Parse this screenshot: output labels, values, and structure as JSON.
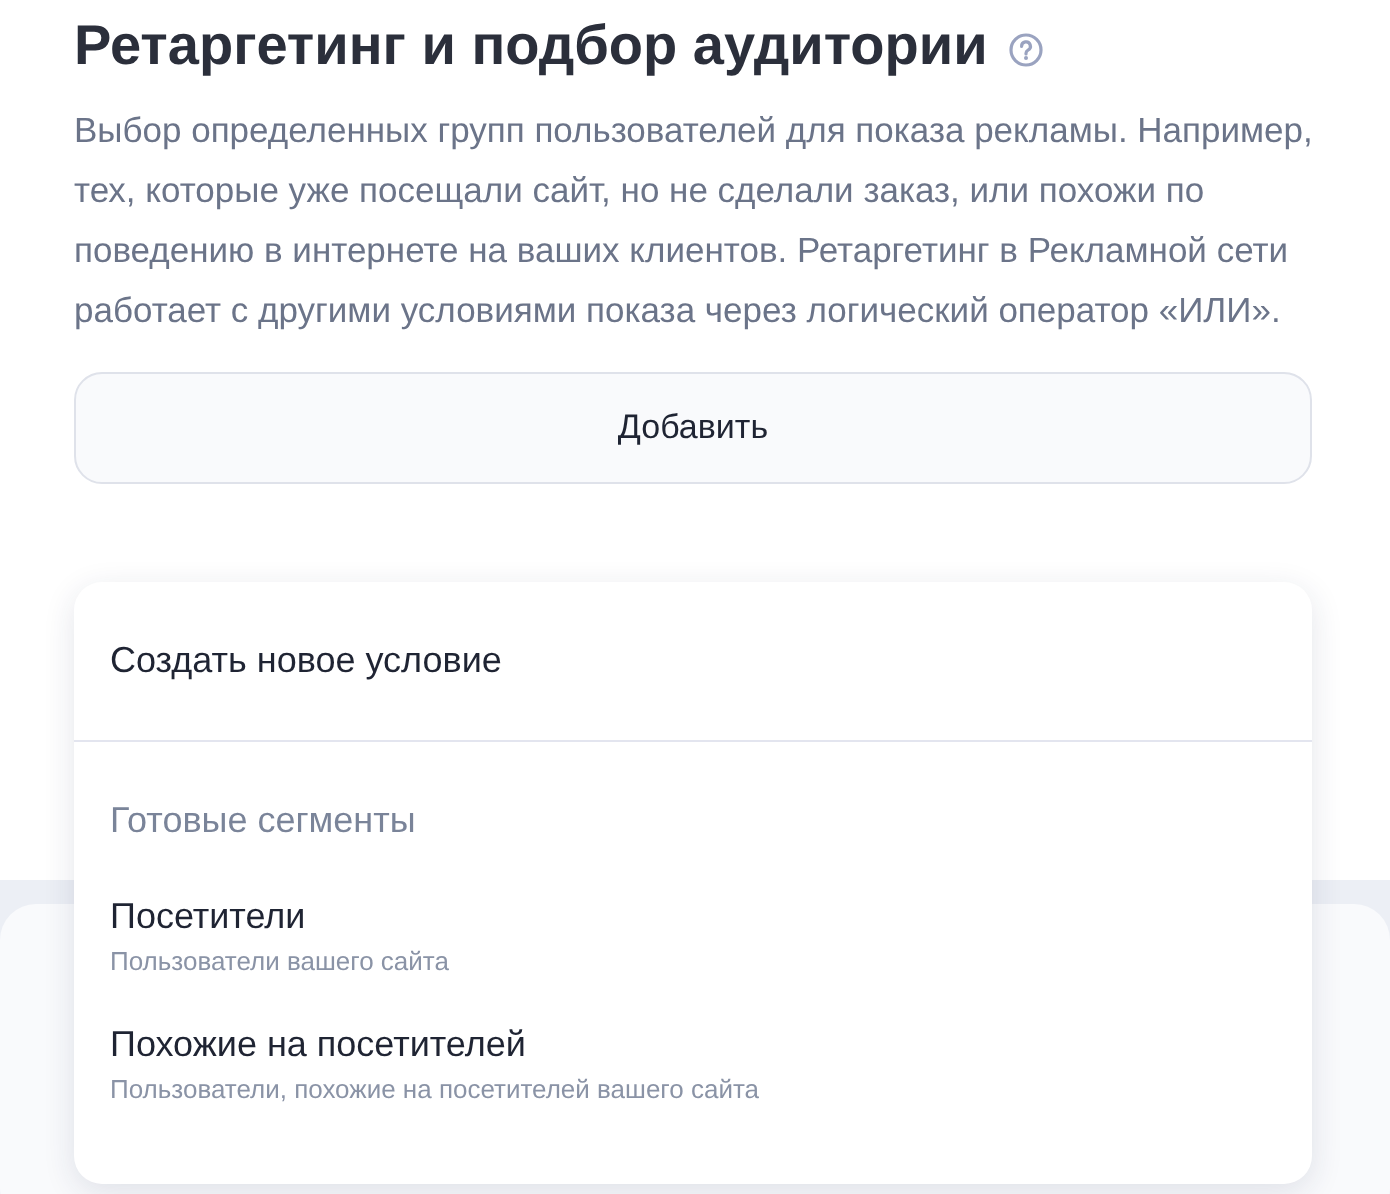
{
  "heading": {
    "title": "Ретаргетинг и подбор аудитории"
  },
  "description": "Выбор определенных групп пользователей для показа рекламы. Например, тех, которые уже посещали сайт, но не сделали заказ, или похожи по поведению в интернете на ваших клиентов. Ретаргетинг в Рекламной сети работает с другими условиями показа через логический оператор «ИЛИ».",
  "add_button": {
    "label": "Добавить"
  },
  "menu": {
    "items": [
      {
        "kind": "action",
        "label": "Создать новое условие"
      },
      {
        "kind": "divider"
      },
      {
        "kind": "header",
        "label": "Готовые сегменты"
      },
      {
        "kind": "option",
        "label": "Посетители",
        "hint": "Пользователи вашего сайта"
      },
      {
        "kind": "option",
        "label": "Похожие на посетителей",
        "hint": "Пользователи, похожие на посетителей вашего сайта"
      }
    ]
  }
}
